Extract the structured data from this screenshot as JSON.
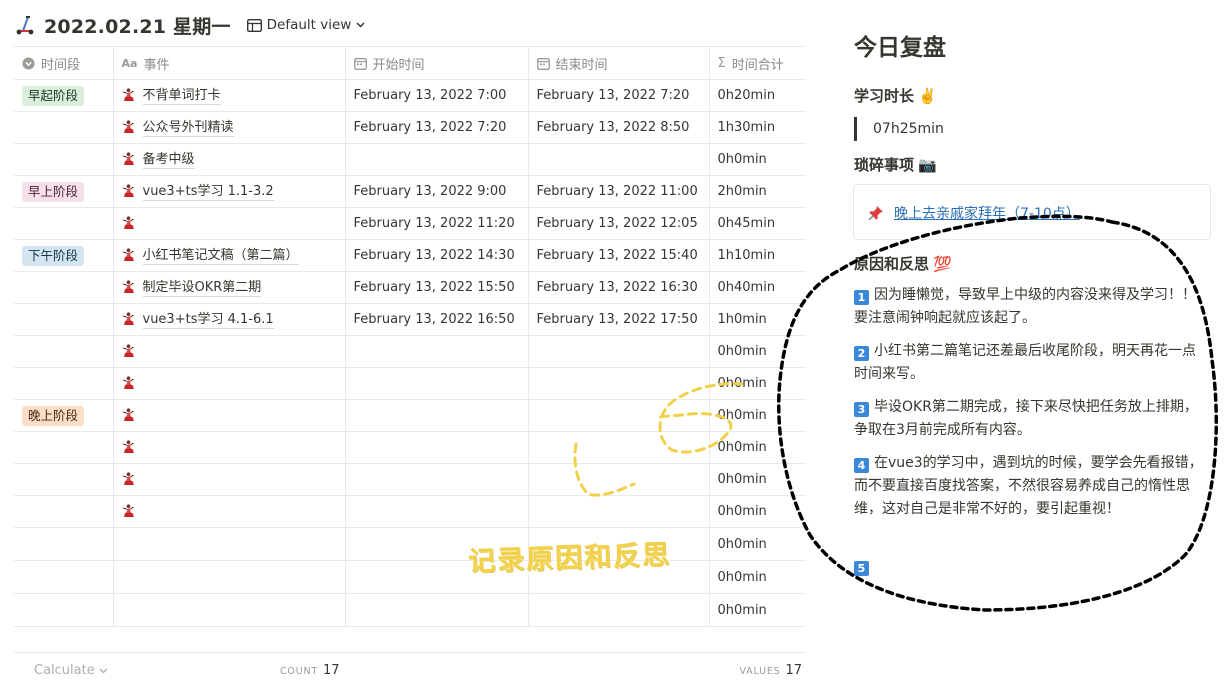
{
  "header": {
    "title": "2022.02.21 星期一",
    "view_label": "Default view"
  },
  "table": {
    "columns": [
      "时间段",
      "事件",
      "开始时间",
      "结束时间",
      "时间合计"
    ],
    "rows": [
      {
        "period": "早起阶段",
        "period_color": "green",
        "event": "不背单词打卡",
        "start": "February 13, 2022 7:00",
        "end": "February 13, 2022 7:20",
        "total": "0h20min"
      },
      {
        "period": "",
        "period_color": "",
        "event": "公众号外刊精读",
        "start": "February 13, 2022 7:20",
        "end": "February 13, 2022 8:50",
        "total": "1h30min"
      },
      {
        "period": "",
        "period_color": "",
        "event": "备考中级",
        "start": "",
        "end": "",
        "total": "0h0min"
      },
      {
        "period": "早上阶段",
        "period_color": "pink",
        "event": "vue3+ts学习 1.1-3.2",
        "start": "February 13, 2022 9:00",
        "end": "February 13, 2022 11:00",
        "total": "2h0min"
      },
      {
        "period": "",
        "period_color": "",
        "event": "",
        "start": "February 13, 2022 11:20",
        "end": "February 13, 2022 12:05",
        "total": "0h45min"
      },
      {
        "period": "下午阶段",
        "period_color": "blue",
        "event": "小红书笔记文稿（第二篇）",
        "start": "February 13, 2022 14:30",
        "end": "February 13, 2022 15:40",
        "total": "1h10min"
      },
      {
        "period": "",
        "period_color": "",
        "event": "制定毕设OKR第二期",
        "start": "February 13, 2022 15:50",
        "end": "February 13, 2022 16:30",
        "total": "0h40min"
      },
      {
        "period": "",
        "period_color": "",
        "event": "vue3+ts学习 4.1-6.1",
        "start": "February 13, 2022 16:50",
        "end": "February 13, 2022 17:50",
        "total": "1h0min"
      },
      {
        "period": "",
        "period_color": "",
        "event": "",
        "start": "",
        "end": "",
        "total": "0h0min"
      },
      {
        "period": "",
        "period_color": "",
        "event": "",
        "start": "",
        "end": "",
        "total": "0h0min"
      },
      {
        "period": "晚上阶段",
        "period_color": "orange",
        "event": "",
        "start": "",
        "end": "",
        "total": "0h0min"
      },
      {
        "period": "",
        "period_color": "",
        "event": "",
        "start": "",
        "end": "",
        "total": "0h0min"
      },
      {
        "period": "",
        "period_color": "",
        "event": "",
        "start": "",
        "end": "",
        "total": "0h0min"
      },
      {
        "period": "",
        "period_color": "",
        "event": "",
        "start": "",
        "end": "",
        "total": "0h0min"
      },
      {
        "period": "",
        "period_color": "",
        "event": "",
        "start": "",
        "end": "",
        "total": "0h0min",
        "no_icon": true
      },
      {
        "period": "",
        "period_color": "",
        "event": "",
        "start": "",
        "end": "",
        "total": "0h0min",
        "no_icon": true
      },
      {
        "period": "",
        "period_color": "",
        "event": "",
        "start": "",
        "end": "",
        "total": "0h0min",
        "no_icon": true
      }
    ]
  },
  "footer": {
    "calculate_label": "Calculate",
    "count_label": "COUNT",
    "count_value": "17",
    "values_label": "VALUES",
    "values_value": "17"
  },
  "review": {
    "title": "今日复盘",
    "study_heading": "学习时长",
    "study_emoji": "✌️",
    "study_value": "07h25min",
    "misc_heading": "琐碎事项",
    "misc_emoji": "📷",
    "misc_link": "晚上去亲戚家拜年（7-10点）",
    "reflect_heading": "原因和反思",
    "reflect_emoji": "💯",
    "items": [
      {
        "num": "1",
        "text": "因为睡懒觉，导致早上中级的内容没来得及学习！！要注意闹钟响起就应该起了。"
      },
      {
        "num": "2",
        "text": "小红书第二篇笔记还差最后收尾阶段，明天再花一点时间来写。"
      },
      {
        "num": "3",
        "text": "毕设OKR第二期完成，接下来尽快把任务放上排期，争取在3月前完成所有内容。"
      },
      {
        "num": "4",
        "text": "在vue3的学习中，遇到坑的时候，要学会先看报错，而不要直接百度找答案，不然很容易养成自己的惰性思维，这对自己是非常不好的，要引起重视！"
      },
      {
        "num": "5",
        "text": ""
      }
    ]
  },
  "annotation": {
    "handwriting": "记录原因和反思"
  },
  "colors": {
    "tag_green": "#dbeddb",
    "tag_pink": "#f5e0e9",
    "tag_blue": "#d3e5ef",
    "tag_orange": "#fadec9",
    "keycap_blue": "#3b87d8",
    "link": "#2b6fb5",
    "scribble_yellow": "#f2d04a"
  }
}
